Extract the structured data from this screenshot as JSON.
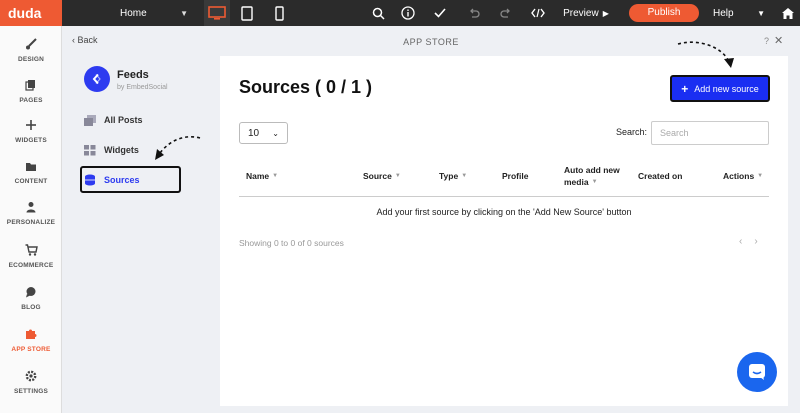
{
  "topbar": {
    "logo": "duda",
    "page_select": "Home",
    "preview": "Preview",
    "publish": "Publish",
    "help": "Help"
  },
  "sidebar": {
    "items": [
      {
        "label": "DESIGN",
        "icon": "brush-icon"
      },
      {
        "label": "PAGES",
        "icon": "pages-icon"
      },
      {
        "label": "WIDGETS",
        "icon": "plus-icon"
      },
      {
        "label": "CONTENT",
        "icon": "folder-icon"
      },
      {
        "label": "PERSONALIZE",
        "icon": "person-icon"
      },
      {
        "label": "ECOMMERCE",
        "icon": "cart-icon"
      },
      {
        "label": "BLOG",
        "icon": "chat-icon"
      },
      {
        "label": "APP STORE",
        "icon": "puzzle-icon",
        "active": true
      },
      {
        "label": "SETTINGS",
        "icon": "gear-icon"
      }
    ]
  },
  "appstore": {
    "back": "Back",
    "title": "APP STORE",
    "help": "?",
    "close": "✕"
  },
  "app": {
    "name": "Feeds",
    "by": "by EmbedSocial",
    "nav": [
      "All Posts",
      "Widgets",
      "Sources"
    ]
  },
  "main": {
    "heading": "Sources ( 0 / 1 )",
    "add_button": "Add new source",
    "per_page": "10",
    "search_label": "Search:",
    "search_placeholder": "Search",
    "columns": [
      "Name",
      "Source",
      "Type",
      "Profile",
      "Auto add new",
      "media",
      "Created on",
      "Actions"
    ],
    "empty_message": "Add your first source by clicking on the 'Add New Source' button",
    "showing": "Showing 0 to 0 of 0 sources",
    "prev": "‹",
    "next": "›"
  },
  "colors": {
    "brand_orange": "#ee5a33",
    "accent_blue": "#1a2ef2",
    "chat_blue": "#1a66ee"
  }
}
